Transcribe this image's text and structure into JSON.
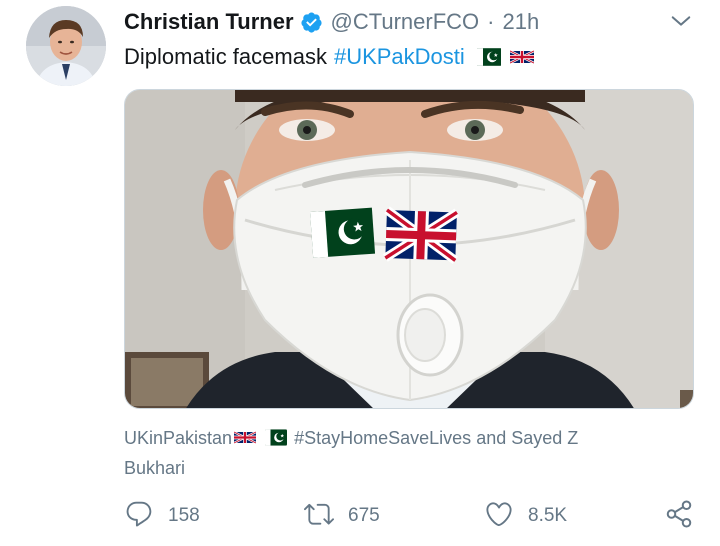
{
  "user": {
    "display_name": "Christian Turner",
    "handle": "@CTurnerFCO",
    "separator": "·",
    "time": "21h",
    "verified_icon": "verified-badge-icon",
    "avatar_icon": "profile-avatar"
  },
  "tweet": {
    "text": "Diplomatic facemask",
    "hashtag": "#UKPakDosti",
    "emojis": [
      "pakistan-flag-icon",
      "uk-flag-icon"
    ]
  },
  "media": {
    "description_icon": "photo-man-wearing-mask-with-pakistan-and-uk-flags"
  },
  "tags_line": {
    "account": "UKinPakistan",
    "hashtag": "#StayHomeSaveLives",
    "tail": "and Sayed Z",
    "tail2": "Bukhari"
  },
  "actions": {
    "reply_count": "158",
    "retweet_count": "675",
    "like_count": "8.5K"
  },
  "colors": {
    "link": "#1b95e0",
    "secondary_text": "#657786",
    "verified": "#1da1f2"
  }
}
